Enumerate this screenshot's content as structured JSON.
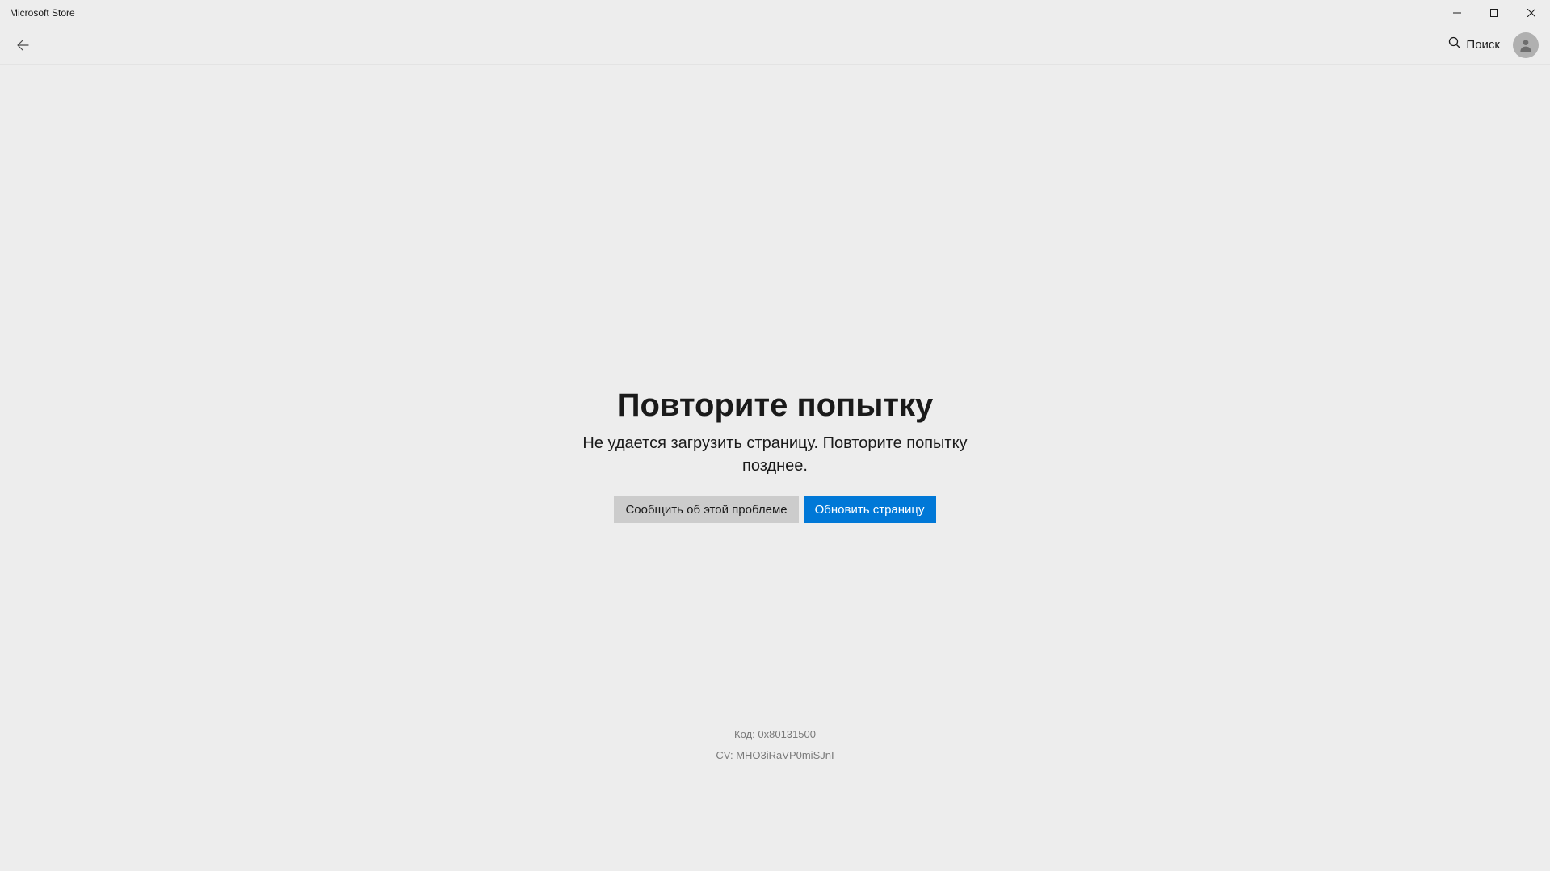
{
  "window": {
    "title": "Microsoft Store"
  },
  "toolbar": {
    "search_label": "Поиск"
  },
  "error": {
    "title": "Повторите попытку",
    "message": "Не удается загрузить страницу. Повторите попытку позднее.",
    "report_label": "Сообщить об этой проблеме",
    "refresh_label": "Обновить страницу"
  },
  "footer": {
    "code_prefix": "Код: ",
    "code_value": "0x80131500",
    "cv_prefix": "CV: ",
    "cv_value": "MHO3iRaVP0miSJnI"
  }
}
